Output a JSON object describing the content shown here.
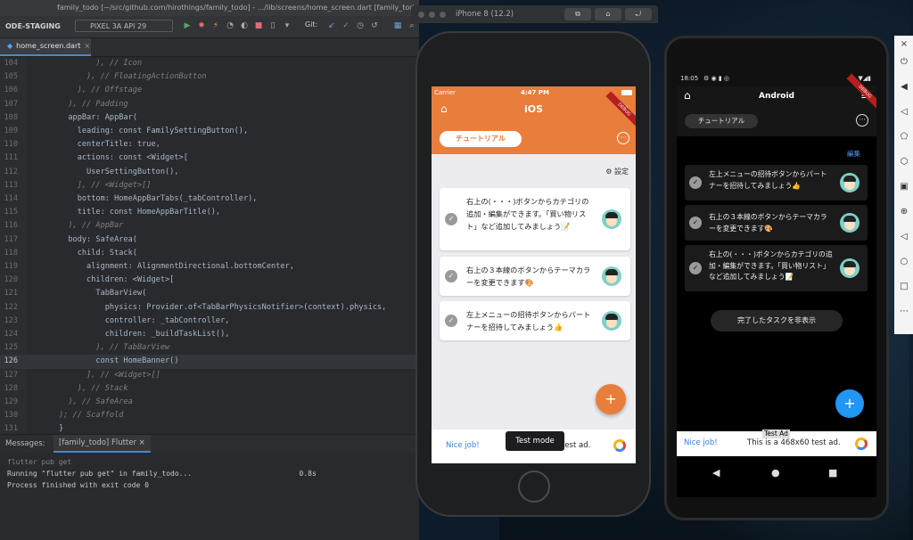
{
  "ide": {
    "title_bar": "family_todo [~/src/github.com/hirothings/family_todo] - .../lib/screens/home_screen.dart [family_todo]",
    "toolbar": {
      "branch": "ODE-STAGING",
      "device": "PIXEL 3A API 29",
      "git_label": "Git:"
    },
    "file_tab": {
      "label": "home_screen.dart",
      "close": "×"
    },
    "code_lines": [
      {
        "ln": "104",
        "text": "        ), // Icon"
      },
      {
        "ln": "105",
        "text": "      ), // FloatingActionButton"
      },
      {
        "ln": "106",
        "text": "    ), // Offstage"
      },
      {
        "ln": "107",
        "text": "  ), // Padding"
      },
      {
        "ln": "108",
        "text": "  appBar: AppBar("
      },
      {
        "ln": "109",
        "text": "    leading: const FamilySettingButton(),"
      },
      {
        "ln": "110",
        "text": "    centerTitle: true,"
      },
      {
        "ln": "111",
        "text": "    actions: const <Widget>["
      },
      {
        "ln": "112",
        "text": "      UserSettingButton(),"
      },
      {
        "ln": "113",
        "text": "    ], // <Widget>[]"
      },
      {
        "ln": "114",
        "text": "    bottom: HomeAppBarTabs(_tabController),"
      },
      {
        "ln": "115",
        "text": "    title: const HomeAppBarTitle(),"
      },
      {
        "ln": "116",
        "text": "  ), // AppBar"
      },
      {
        "ln": "117",
        "text": "  body: SafeArea("
      },
      {
        "ln": "118",
        "text": "    child: Stack("
      },
      {
        "ln": "119",
        "text": "      alignment: AlignmentDirectional.bottomCenter,"
      },
      {
        "ln": "120",
        "text": "      children: <Widget>["
      },
      {
        "ln": "121",
        "text": "        TabBarView("
      },
      {
        "ln": "122",
        "text": "          physics: Provider.of<TabBarPhysicsNotifier>(context).physics,"
      },
      {
        "ln": "123",
        "text": "          controller: _tabController,"
      },
      {
        "ln": "124",
        "text": "          children: _buildTaskList(),"
      },
      {
        "ln": "125",
        "text": "        ), // TabBarView"
      },
      {
        "ln": "126",
        "text": "        const HomeBanner()"
      },
      {
        "ln": "127",
        "text": "      ], // <Widget>[]"
      },
      {
        "ln": "128",
        "text": "    ), // Stack"
      },
      {
        "ln": "129",
        "text": "  ), // SafeArea"
      },
      {
        "ln": "130",
        "text": "); // Scaffold"
      },
      {
        "ln": "131",
        "text": "}"
      }
    ],
    "current_line": "126",
    "messages": {
      "label": "Messages:",
      "tab": "[family_todo] Flutter ×"
    },
    "console": [
      {
        "text": "flutter pub get",
        "dim": true
      },
      {
        "text": "Running \"flutter pub get\" in family_todo...                         0.8s",
        "dim": false
      },
      {
        "text": "Process finished with exit code 0",
        "dim": false
      }
    ]
  },
  "simulator": {
    "title": "iPhone 8 (12.2)"
  },
  "ios_app": {
    "status": {
      "carrier": "Carrier",
      "time": "4:47 PM"
    },
    "title": "iOS",
    "debug": "DEBUG",
    "tutorial": "チュートリアル",
    "settings": "設定",
    "tasks": [
      "右上の(・・・)ボタンからカテゴリの追加・編集ができます。「買い物リスト」など追加してみましょう📝",
      "右上の３本線のボタンからテーマカラーを変更できます🎨",
      "左上メニューの招待ボタンからパートナーを招待してみましょう👍"
    ],
    "fab": "+",
    "ad": {
      "nice": "Nice job!",
      "tail": "test ad."
    },
    "test_mode": "Test mode"
  },
  "android_app": {
    "status": {
      "time": "18:05"
    },
    "title": "Android",
    "debug": "DEBUG",
    "tutorial": "チュートリアル",
    "edit": "編集",
    "tasks": [
      "左上メニューの招待ボタンからパートナーを招待してみましょう👍",
      "右上の３本線のボタンからテーマカラーを変更できます🎨",
      "右上の(・・・)ボタンからカテゴリの追加・編集ができます。「買い物リスト」など追加してみましょう📝"
    ],
    "hide_completed": "完了したタスクを非表示",
    "fab": "+",
    "test_ad_label": "Test Ad",
    "ad": {
      "nice": "Nice job!",
      "text": "This is a 468x60 test ad."
    },
    "nav": {
      "back": "◀",
      "home": "●",
      "recents": "■"
    }
  },
  "colors": {
    "ios_accent": "#e97d3c",
    "android_fab": "#2196f3",
    "ide_bg": "#282a2e"
  }
}
